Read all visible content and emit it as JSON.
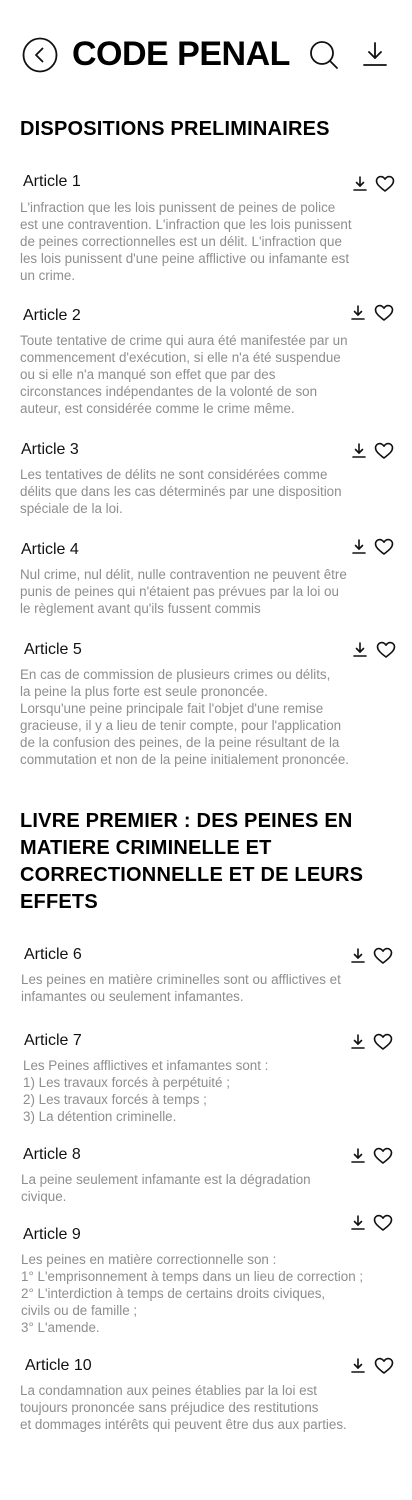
{
  "header": {
    "title": "CODE PENAL"
  },
  "sections": [
    {
      "title": "DISPOSITIONS PRELIMINAIRES",
      "articles": [
        {
          "title": "Article 1",
          "body": "L'infraction que les lois punissent de peines de police\nest une contravention. L'infraction que les lois punissent\nde peines correctionnelles est un délit. L'infraction que\nles lois punissent d'une peine afflictive ou infamante est\nun crime."
        },
        {
          "title": "Article 2",
          "body": "Toute tentative de crime qui aura été manifestée par un\ncommencement d'exécution, si elle n'a été suspendue\nou si elle n'a manqué son effet que par des\ncirconstances indépendantes de la volonté de son\nauteur, est considérée comme le crime même."
        },
        {
          "title": "Article 3",
          "body": "Les tentatives de délits ne sont considérées comme\ndélits que dans les cas déterminés par une disposition\nspéciale de la loi."
        },
        {
          "title": "Article 4",
          "body": "Nul crime, nul délit, nulle contravention ne peuvent être\npunis de peines qui n'étaient pas prévues par la loi ou\nle règlement avant qu'ils fussent commis"
        },
        {
          "title": "Article 5",
          "body": "En cas de commission de plusieurs crimes ou délits,\nla peine la plus forte est seule prononcée.\nLorsqu'une peine principale fait l'objet d'une remise\ngracieuse, il y a lieu de tenir compte, pour l'application\nde la confusion des peines, de la peine résultant de la\ncommutation et non de la peine initialement prononcée."
        }
      ]
    },
    {
      "title": "LIVRE PREMIER : DES PEINES EN MATIERE CRIMINELLE ET CORRECTIONNELLE ET DE LEURS EFFETS",
      "articles": [
        {
          "title": "Article 6",
          "body": "Les peines en matière criminelles sont ou afflictives et\ninfamantes ou seulement infamantes."
        },
        {
          "title": "Article 7",
          "body": "Les Peines afflictives et infamantes sont :\n1) Les travaux forcés à perpétuité ;\n2) Les travaux forcés à temps ;\n3) La détention criminelle."
        },
        {
          "title": "Article 8",
          "body": "La peine seulement infamante est la dégradation\ncivique."
        },
        {
          "title": "Article 9",
          "body": "Les peines en matière correctionnelle son :\n1° L'emprisonnement à temps dans un lieu de correction ;\n2° L'interdiction à temps de certains droits civiques,\n     civils ou de famille ;\n3° L'amende."
        },
        {
          "title": "Article 10",
          "body": "La condamnation aux peines établies par la loi est\ntoujours prononcée sans préjudice des restitutions\net dommages intérêts qui peuvent être dus aux parties."
        }
      ]
    }
  ],
  "icons": {
    "header": [
      "back-icon",
      "search-icon",
      "download-icon"
    ],
    "article": [
      "download-icon",
      "heart-icon"
    ]
  },
  "colors": {
    "title": "#000000",
    "article_title": "#111111",
    "body_text": "#8e8e8e",
    "background": "#ffffff"
  }
}
